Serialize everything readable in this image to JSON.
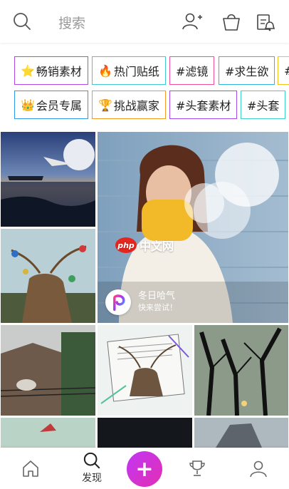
{
  "header": {
    "search_placeholder": "搜索",
    "icons": [
      "search-icon",
      "add-user-icon",
      "shop-bag-icon",
      "notification-bell-icon"
    ]
  },
  "tags_row1": [
    {
      "label": "畅销素材",
      "icon": "star-icon",
      "emoji": "⭐",
      "color": "#b347e6"
    },
    {
      "label": "热门贴纸",
      "icon": "flame-icon",
      "emoji": "🔥",
      "color": "#3fc9d6"
    },
    {
      "label": "#滤镜",
      "icon": "",
      "emoji": "",
      "color": "#ef4f9a"
    },
    {
      "label": "#求生欲",
      "icon": "",
      "emoji": "",
      "color": "#2fb6e0"
    },
    {
      "label": "#",
      "icon": "",
      "emoji": "",
      "color": "#f2c21a"
    }
  ],
  "tags_row2": [
    {
      "label": "会员专属",
      "icon": "crown-icon",
      "emoji": "👑",
      "color": "#2f9be8"
    },
    {
      "label": "挑战赢家",
      "icon": "trophy-icon",
      "emoji": "🏆",
      "color": "#f39a1f"
    },
    {
      "label": "#头套素材",
      "icon": "",
      "emoji": "",
      "color": "#a64ae8"
    },
    {
      "label": "#头套",
      "icon": "",
      "emoji": "",
      "color": "#3fd0c9"
    }
  ],
  "feature": {
    "title": "冬日哈气",
    "subtitle": "快来尝试！"
  },
  "watermark": {
    "badge": "php",
    "text": "中文网"
  },
  "nav": {
    "discover_label": "发现",
    "plus_label": "+"
  },
  "colors": {
    "accent_gradient_start": "#c236f5",
    "accent_gradient_end": "#e22fb2"
  }
}
